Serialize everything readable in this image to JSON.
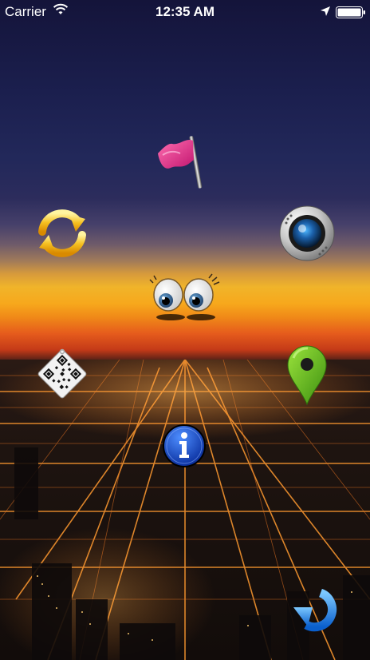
{
  "status_bar": {
    "carrier": "Carrier",
    "time": "12:35 AM",
    "icons": [
      "wifi-icon",
      "location-arrow-icon",
      "battery-icon"
    ]
  },
  "buttons": [
    {
      "name": "flag-button",
      "icon": "pink-flag-icon"
    },
    {
      "name": "refresh-button",
      "icon": "circular-arrows-icon"
    },
    {
      "name": "camera-button",
      "icon": "camera-icon"
    },
    {
      "name": "eyes-button",
      "icon": "cartoon-eyes-icon"
    },
    {
      "name": "qr-code-button",
      "icon": "qr-code-tag-icon"
    },
    {
      "name": "map-pin-button",
      "icon": "green-map-pin-icon"
    },
    {
      "name": "info-button",
      "icon": "info-icon"
    },
    {
      "name": "undo-button",
      "icon": "rotate-arrow-icon"
    }
  ],
  "colors": {
    "sky_top": "#14143a",
    "horizon": "#f7a81c",
    "horizon_red": "#e65c1c",
    "city_lights": "#ff9a30"
  }
}
